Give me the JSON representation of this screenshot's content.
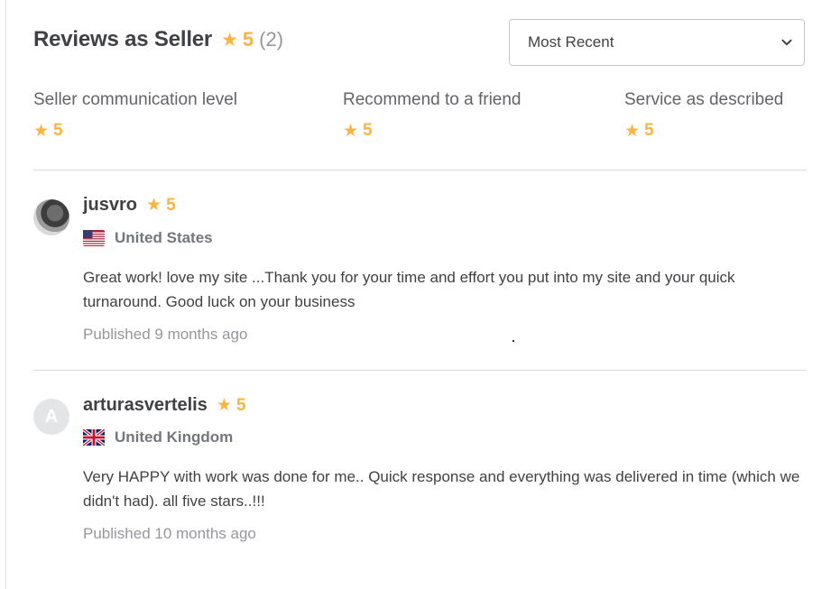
{
  "header": {
    "title": "Reviews as Seller",
    "overall_rating": "5",
    "review_count": "(2)"
  },
  "sort": {
    "selected": "Most Recent"
  },
  "breakdown": [
    {
      "label": "Seller communication level",
      "rating": "5"
    },
    {
      "label": "Recommend to a friend",
      "rating": "5"
    },
    {
      "label": "Service as described",
      "rating": "5"
    }
  ],
  "reviews": [
    {
      "username": "jusvro",
      "rating": "5",
      "country": "United States",
      "text": "Great work! love my site ...Thank you for your time and effort you put into my site and your quick turnaround. Good luck on your business",
      "published": "Published 9 months ago"
    },
    {
      "username": "arturasvertelis",
      "avatar_letter": "A",
      "rating": "5",
      "country": "United Kingdom",
      "text": "Very HAPPY with work was done for me.. Quick response and everything was delivered in time (which we didn't had). all five stars..!!!",
      "published": "Published 10 months ago"
    }
  ],
  "colors": {
    "star": "#ffb33e",
    "text": "#404145",
    "muted": "#95979d",
    "divider": "#dadbdd"
  },
  "icons": {
    "rating": "star-icon",
    "sort": "chevron-down-icon"
  }
}
